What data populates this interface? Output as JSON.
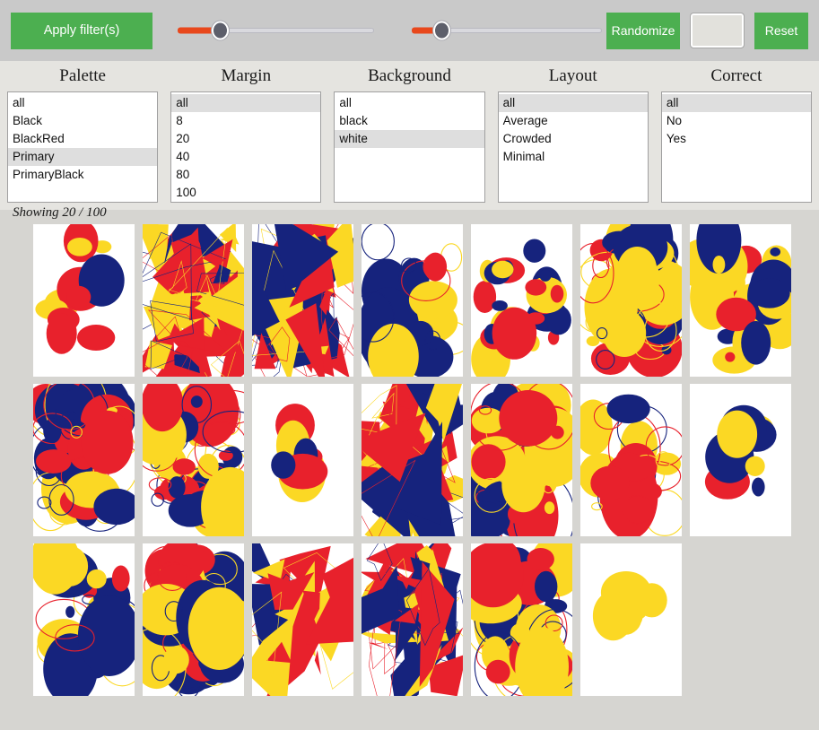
{
  "toolbar": {
    "apply_label": "Apply filter(s)",
    "randomize_label": "Randomize",
    "reset_label": "Reset",
    "blank_field_value": "",
    "blank_field_placeholder": "",
    "slider_one": {
      "value_pct": 22,
      "min": 0,
      "max": 100
    },
    "slider_two": {
      "value_pct": 16,
      "min": 0,
      "max": 100
    },
    "accent_green": "#4caf50",
    "slider_fill_color": "#e8481c",
    "slider_thumb_color": "#5d5f6b"
  },
  "filters": {
    "columns": [
      {
        "title": "Palette",
        "name": "palette",
        "options": [
          "all",
          "Black",
          "BlackRed",
          "Primary",
          "PrimaryBlack"
        ],
        "selected": "Primary"
      },
      {
        "title": "Margin",
        "name": "margin",
        "options": [
          "all",
          "8",
          "20",
          "40",
          "80",
          "100"
        ],
        "selected": "all"
      },
      {
        "title": "Background",
        "name": "background",
        "options": [
          "all",
          "black",
          "white"
        ],
        "selected": "white"
      },
      {
        "title": "Layout",
        "name": "layout",
        "options": [
          "all",
          "Average",
          "Crowded",
          "Minimal"
        ],
        "selected": "all"
      },
      {
        "title": "Correct",
        "name": "correct",
        "options": [
          "all",
          "No",
          "Yes"
        ],
        "selected": "all"
      }
    ]
  },
  "status": {
    "showing": "Showing 20 / 100",
    "shown_count": 20,
    "total_count": 100
  },
  "gallery": {
    "palette": {
      "navy": "#16237d",
      "red": "#e8212c",
      "yellow": "#fbd824",
      "white": "#ffffff"
    },
    "rows": [
      [
        {
          "id": 1,
          "style": "blobs",
          "density": "sparse",
          "colors": [
            "navy",
            "red",
            "yellow"
          ]
        },
        {
          "id": 2,
          "style": "shards",
          "density": "crowded",
          "colors": [
            "navy",
            "yellow",
            "red"
          ]
        },
        {
          "id": 3,
          "style": "shards",
          "density": "crowded",
          "colors": [
            "yellow",
            "navy",
            "red"
          ]
        },
        {
          "id": 4,
          "style": "rings",
          "density": "average",
          "colors": [
            "navy",
            "red",
            "yellow"
          ]
        },
        {
          "id": 5,
          "style": "blobs",
          "density": "average",
          "colors": [
            "navy",
            "red",
            "yellow"
          ]
        },
        {
          "id": 6,
          "style": "rings",
          "density": "crowded",
          "colors": [
            "navy",
            "yellow",
            "red"
          ]
        },
        {
          "id": 7,
          "style": "blobs",
          "density": "average",
          "colors": [
            "yellow",
            "navy",
            "red"
          ]
        }
      ],
      [
        {
          "id": 8,
          "style": "rings",
          "density": "crowded",
          "colors": [
            "red",
            "navy",
            "yellow"
          ]
        },
        {
          "id": 9,
          "style": "rings",
          "density": "crowded",
          "colors": [
            "navy",
            "yellow",
            "red"
          ]
        },
        {
          "id": 10,
          "style": "blobs",
          "density": "minimal",
          "colors": [
            "navy",
            "yellow",
            "red"
          ]
        },
        {
          "id": 11,
          "style": "shards",
          "density": "crowded",
          "colors": [
            "red",
            "navy",
            "yellow"
          ]
        },
        {
          "id": 12,
          "style": "rings",
          "density": "crowded",
          "colors": [
            "red",
            "navy",
            "yellow"
          ]
        },
        {
          "id": 13,
          "style": "rings",
          "density": "average",
          "colors": [
            "red",
            "navy",
            "yellow"
          ]
        },
        {
          "id": 14,
          "style": "blobs",
          "density": "minimal",
          "colors": [
            "navy",
            "yellow",
            "red"
          ]
        }
      ],
      [
        {
          "id": 15,
          "style": "rings",
          "density": "average",
          "colors": [
            "navy",
            "red",
            "yellow"
          ]
        },
        {
          "id": 16,
          "style": "rings",
          "density": "crowded",
          "colors": [
            "yellow",
            "red",
            "navy"
          ]
        },
        {
          "id": 17,
          "style": "shards",
          "density": "average",
          "colors": [
            "navy",
            "yellow",
            "red"
          ]
        },
        {
          "id": 18,
          "style": "shards",
          "density": "crowded",
          "colors": [
            "red",
            "yellow",
            "navy"
          ]
        },
        {
          "id": 19,
          "style": "rings",
          "density": "crowded",
          "colors": [
            "yellow",
            "red",
            "navy"
          ]
        },
        {
          "id": 20,
          "style": "blobs",
          "density": "minimal",
          "colors": [
            "yellow"
          ]
        }
      ]
    ]
  }
}
